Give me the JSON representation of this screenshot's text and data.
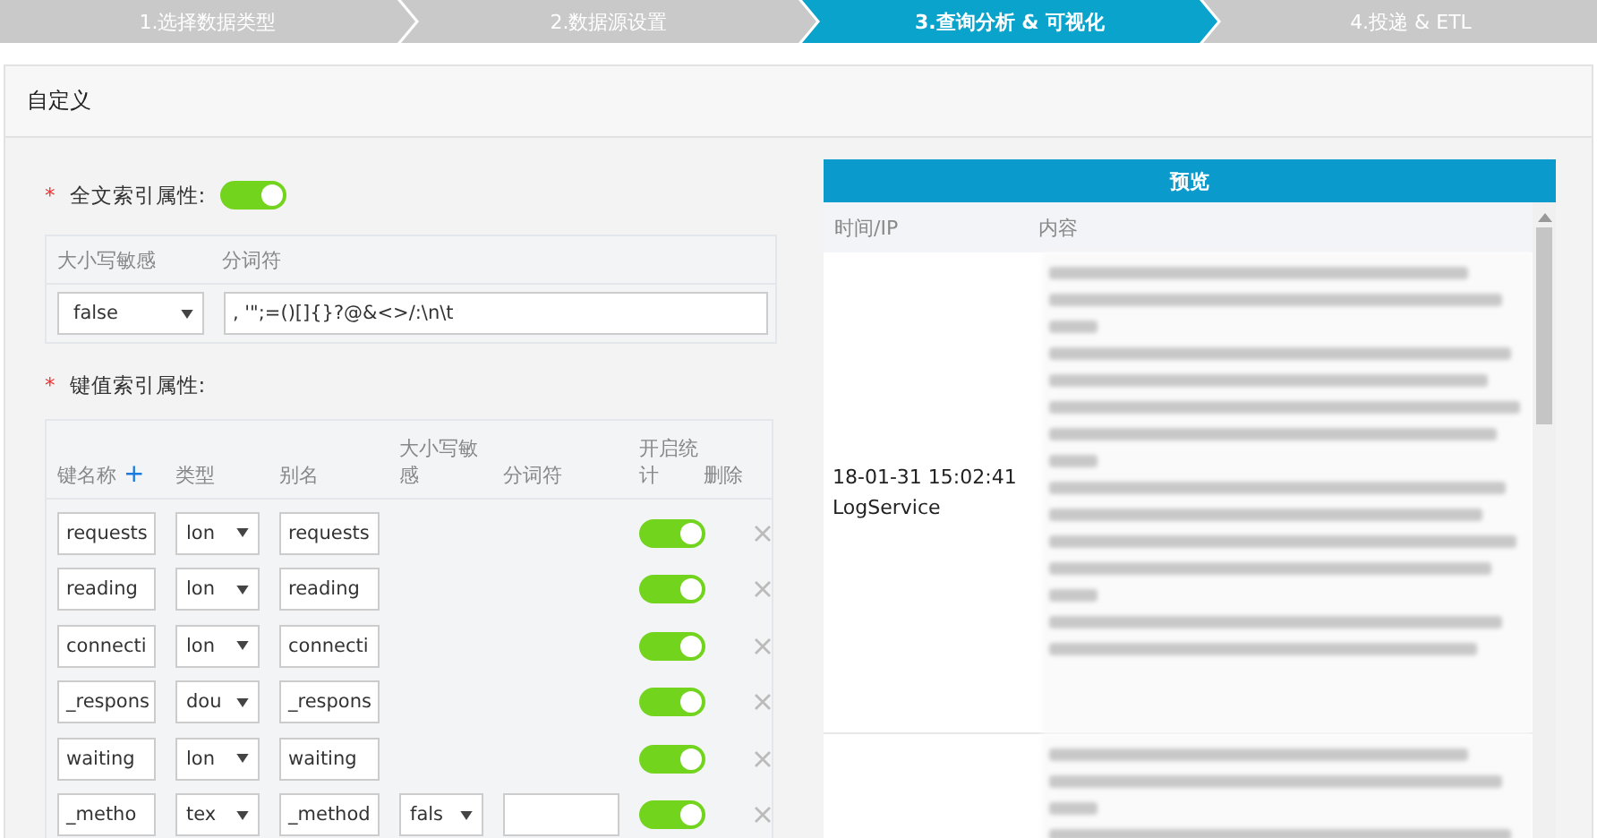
{
  "steps": [
    {
      "label": "1.选择数据类型",
      "selected": false
    },
    {
      "label": "2.数据源设置",
      "selected": false
    },
    {
      "label": "3.查询分析 & 可视化",
      "selected": true
    },
    {
      "label": "4.投递 & ETL",
      "selected": false
    }
  ],
  "panel": {
    "title": "自定义"
  },
  "required_mark": "*",
  "fulltext": {
    "label": "全文索引属性:",
    "on": true,
    "columns": [
      "大小写敏感",
      "分词符"
    ],
    "case_sensitive": "false",
    "delimiter": ", '\";=()[]{}?@&<>/:\\n\\t"
  },
  "keyvalue": {
    "label": "键值索引属性:",
    "add": "+",
    "columns": [
      "键名称",
      "类型",
      "别名",
      "大小写敏感",
      "分词符",
      "开启统计",
      "删除"
    ],
    "rows": [
      {
        "kind": "number",
        "name": "requests",
        "type": "lon",
        "alias": "requests",
        "stats_on": true
      },
      {
        "kind": "number",
        "name": "reading",
        "type": "lon",
        "alias": "reading",
        "stats_on": true
      },
      {
        "kind": "number",
        "name": "connecti",
        "type": "lon",
        "alias": "connecti",
        "stats_on": true
      },
      {
        "kind": "number",
        "name": "_respons",
        "type": "dou",
        "alias": "_respons",
        "stats_on": true
      },
      {
        "kind": "number",
        "name": "waiting",
        "type": "lon",
        "alias": "waiting",
        "stats_on": true
      },
      {
        "kind": "text",
        "name": "_metho",
        "type": "tex",
        "alias": "_method",
        "case_sensitive": "fals",
        "stats_on": true
      }
    ]
  },
  "preview": {
    "title": "预览",
    "columns": [
      "时间/IP",
      "内容"
    ],
    "rows": [
      {
        "time": "18-01-31 15:02:41",
        "source": "LogService"
      },
      {}
    ]
  }
}
